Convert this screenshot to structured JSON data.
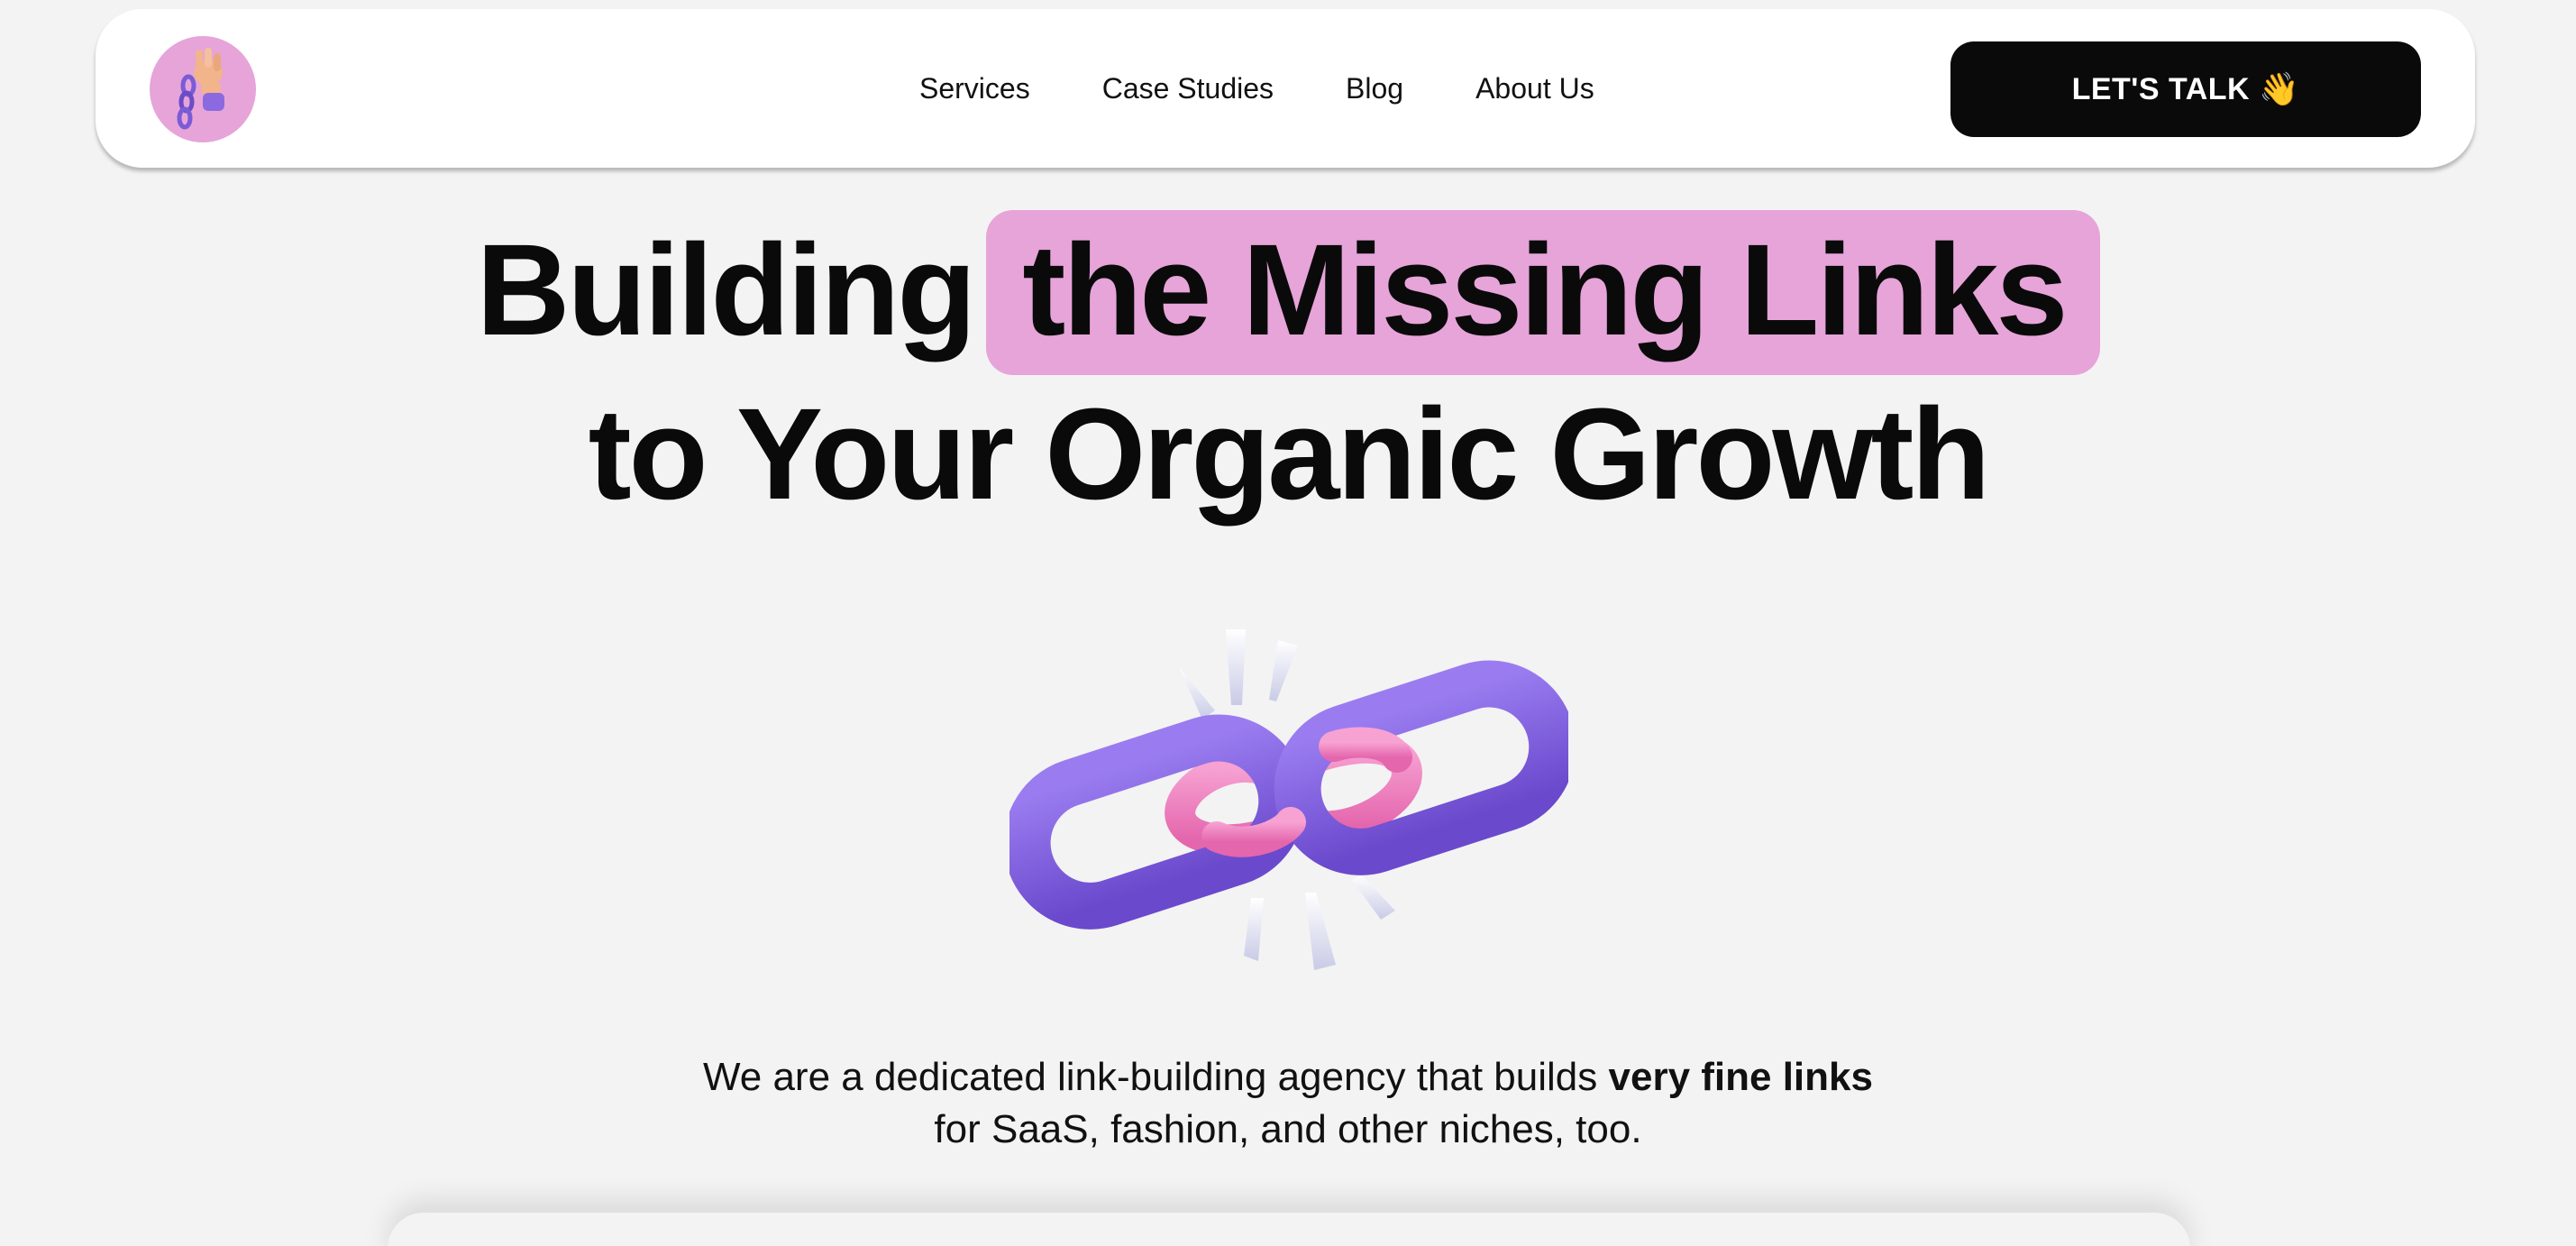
{
  "nav": {
    "logo_icon": "hand-holding-chain-icon",
    "links": [
      "Services",
      "Case Studies",
      "Blog",
      "About Us"
    ],
    "cta_label": "LET'S TALK",
    "cta_icon": "waving-hand-icon",
    "cta_emoji": "👋"
  },
  "hero": {
    "headline_part1": "Building",
    "headline_highlight": "the Missing Links",
    "headline_line2": "to Your Organic Growth",
    "illustration_icon": "broken-chain-link-icon",
    "subtitle_part1": "We are a dedicated link-building agency that builds ",
    "subtitle_bold": "very fine links",
    "subtitle_line2": "for SaaS, fashion, and other niches, too."
  },
  "colors": {
    "accent_pink": "#e6a4d9",
    "chain_purple": "#7b5cd6",
    "chain_pink": "#ef7fbf",
    "cta_bg": "#0a0a0a",
    "page_bg": "#f3f3f3"
  }
}
